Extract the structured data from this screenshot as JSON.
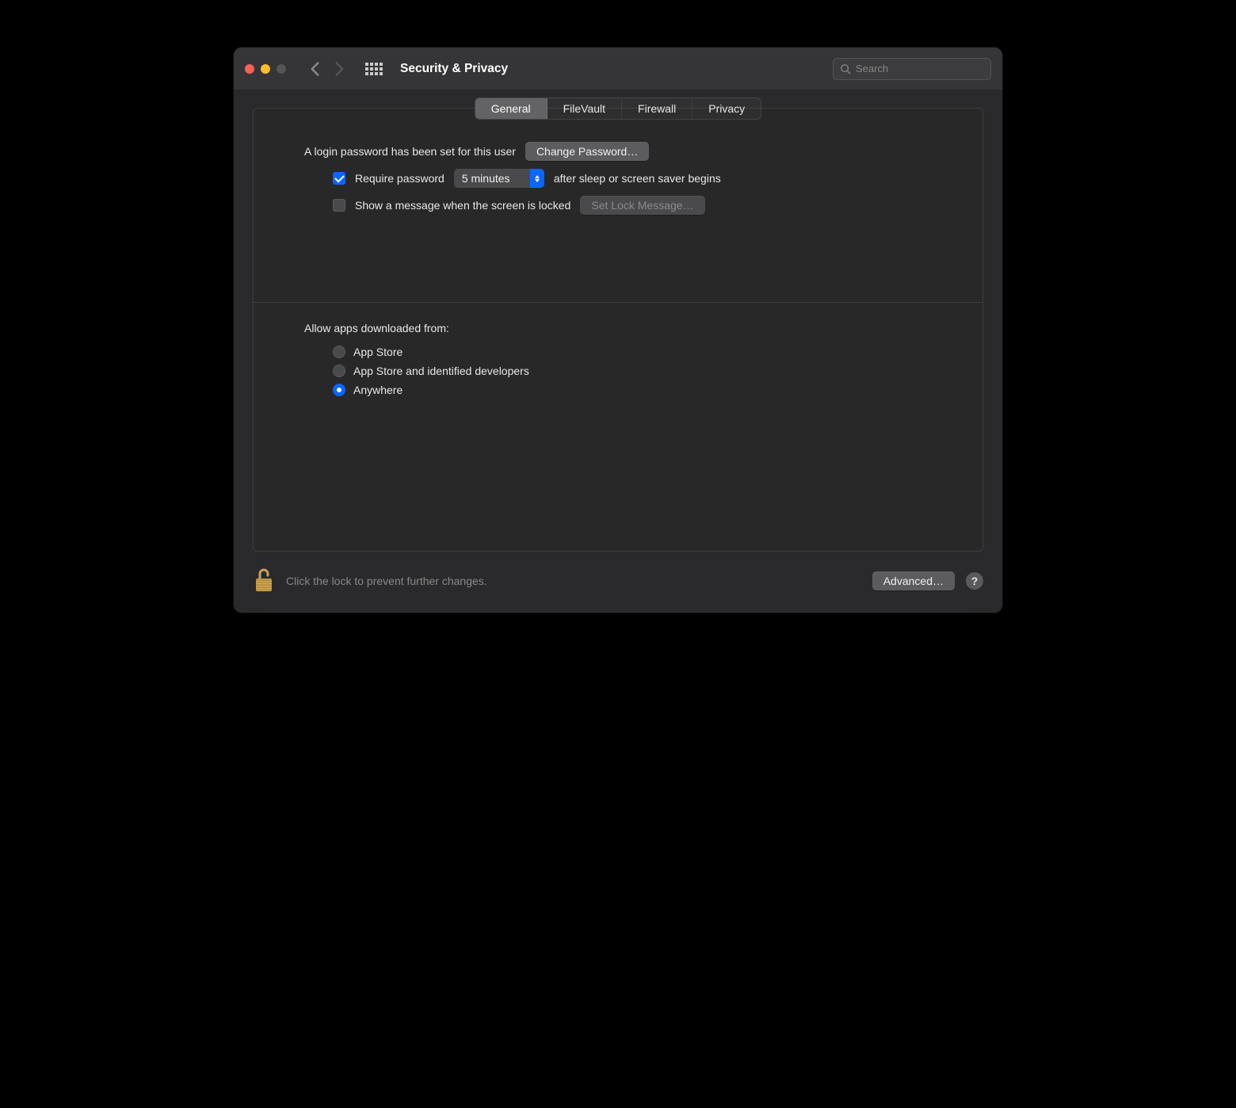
{
  "window": {
    "title": "Security & Privacy"
  },
  "search": {
    "placeholder": "Search",
    "value": ""
  },
  "tabs": {
    "items": [
      "General",
      "FileVault",
      "Firewall",
      "Privacy"
    ],
    "active": "General"
  },
  "general": {
    "login_password_text": "A login password has been set for this user",
    "change_password_btn": "Change Password…",
    "require_password_label": "Require password",
    "require_password_after": "after sleep or screen saver begins",
    "delay_selected": "5 minutes",
    "show_lock_message_label": "Show a message when the screen is locked",
    "set_lock_message_btn": "Set Lock Message…",
    "allow_apps_heading": "Allow apps downloaded from:",
    "allow_apps_options": [
      "App Store",
      "App Store and identified developers",
      "Anywhere"
    ],
    "allow_apps_selected": "Anywhere"
  },
  "footer": {
    "lock_text": "Click the lock to prevent further changes.",
    "advanced_btn": "Advanced…",
    "help": "?"
  }
}
